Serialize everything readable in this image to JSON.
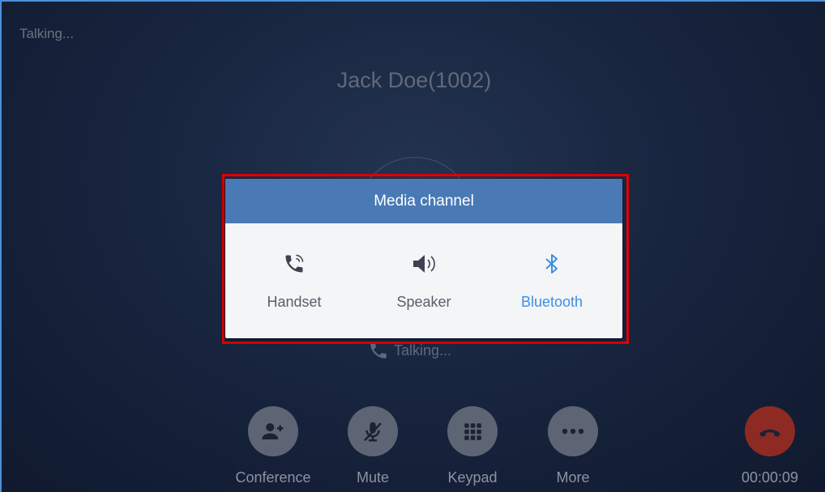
{
  "status_text": "Talking...",
  "caller_name": "Jack Doe(1002)",
  "call_state": "Talking...",
  "dialog": {
    "title": "Media channel",
    "options": [
      {
        "label": "Handset",
        "icon": "handset-icon",
        "selected": false
      },
      {
        "label": "Speaker",
        "icon": "speaker-icon",
        "selected": false
      },
      {
        "label": "Bluetooth",
        "icon": "bluetooth-icon",
        "selected": true
      }
    ]
  },
  "actions": [
    {
      "label": "Conference",
      "icon": "add-user-icon"
    },
    {
      "label": "Mute",
      "icon": "mic-off-icon"
    },
    {
      "label": "Keypad",
      "icon": "keypad-icon"
    },
    {
      "label": "More",
      "icon": "more-icon"
    }
  ],
  "hangup": {
    "timer": "00:00:09",
    "icon": "hang-up-icon"
  },
  "colors": {
    "dialog_header": "#4a7ab5",
    "selected_option": "#3d8fe0",
    "highlight_outline": "#e00000",
    "hangup": "#8e2a24"
  }
}
